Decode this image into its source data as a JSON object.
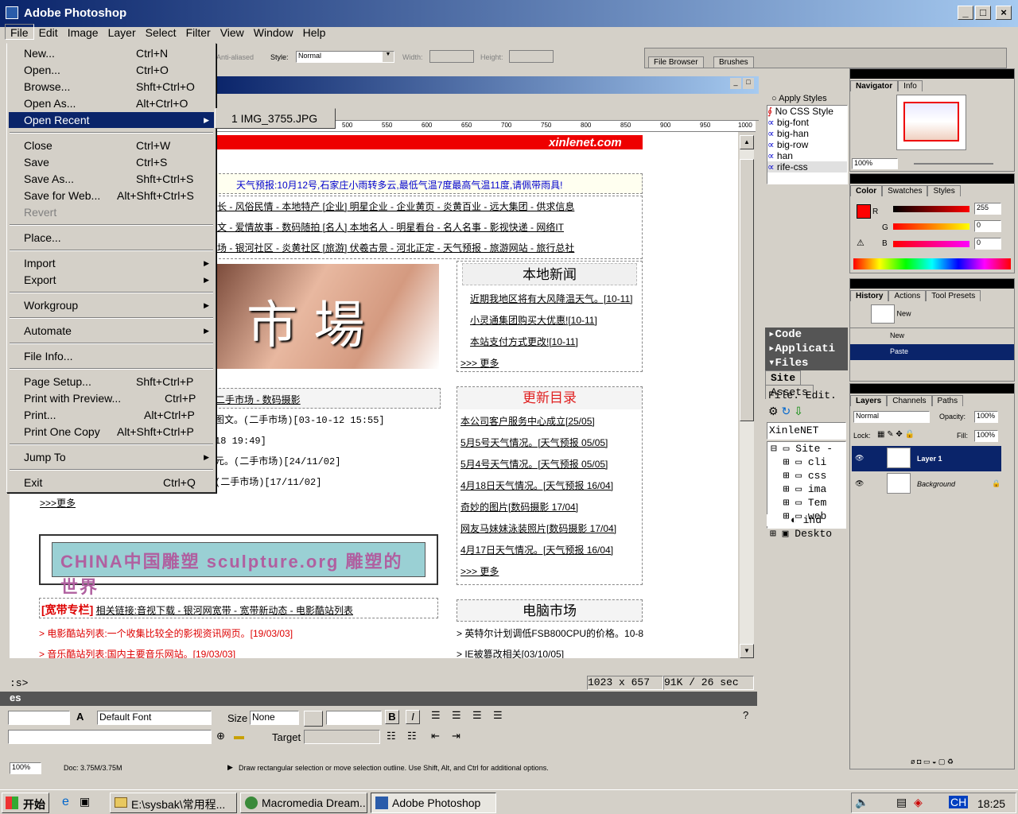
{
  "window": {
    "title": "Adobe Photoshop"
  },
  "menubar": [
    "File",
    "Edit",
    "Image",
    "Layer",
    "Select",
    "Filter",
    "View",
    "Window",
    "Help"
  ],
  "options": {
    "style_label": "Style:",
    "style_value": "Normal",
    "width_label": "Width:",
    "height_label": "Height:",
    "anti": "Anti-aliased",
    "file_browser": "File Browser",
    "brushes": "Brushes"
  },
  "file_menu": [
    {
      "label": "New...",
      "sc": "Ctrl+N"
    },
    {
      "label": "Open...",
      "sc": "Ctrl+O"
    },
    {
      "label": "Browse...",
      "sc": "Shft+Ctrl+O"
    },
    {
      "label": "Open As...",
      "sc": "Alt+Ctrl+O"
    },
    {
      "label": "Open Recent",
      "sc": ""
    },
    {
      "label": "Close",
      "sc": "Ctrl+W"
    },
    {
      "label": "Save",
      "sc": "Ctrl+S"
    },
    {
      "label": "Save As...",
      "sc": "Shft+Ctrl+S"
    },
    {
      "label": "Save for Web...",
      "sc": "Alt+Shft+Ctrl+S"
    },
    {
      "label": "Revert",
      "sc": ""
    },
    {
      "label": "Place...",
      "sc": ""
    },
    {
      "label": "Import",
      "sc": ""
    },
    {
      "label": "Export",
      "sc": ""
    },
    {
      "label": "Workgroup",
      "sc": ""
    },
    {
      "label": "Automate",
      "sc": ""
    },
    {
      "label": "File Info...",
      "sc": ""
    },
    {
      "label": "Page Setup...",
      "sc": "Shft+Ctrl+P"
    },
    {
      "label": "Print with Preview...",
      "sc": "Ctrl+P"
    },
    {
      "label": "Print...",
      "sc": "Alt+Ctrl+P"
    },
    {
      "label": "Print One Copy",
      "sc": "Alt+Shft+Ctrl+P"
    },
    {
      "label": "Jump To",
      "sc": ""
    },
    {
      "label": "Exit",
      "sc": "Ctrl+Q"
    }
  ],
  "recent": "1 IMG_3755.JPG",
  "web": {
    "weather": "天气预报:10月12号,石家庄小雨转多云,最低气温7度最高气温11度,请佩带雨具!",
    "nav_rows": [
      "长 - 风俗民情 - 本地特产    [企业] 明星企业 - 企业黄页 - 炎黄百业 - 远大集团 - 供求信息",
      "文 - 爱情故事 - 数码随拍    [名人] 本地名人 - 明星看台 - 名人名事 - 影视快递 - 网络IT",
      "场 - 银河社区 - 炎黄社区    [旅游] 伏羲古景 - 河北正定 - 天气预报 - 旅游网站 - 旅行总社"
    ],
    "logo": "xinlenet.com",
    "news_title": "本地新闻",
    "news": [
      "近期我地区将有大风降温天气。[10-11]",
      "小灵通集团购买大优惠![10-11]",
      "本站支付方式更改![10-11]",
      ">>> 更多"
    ],
    "market_head": "二手市场 - 数码摄影",
    "market": [
      "图文。(二手市场)[03-10-12 15:55]",
      "18 19:49]",
      "元。(二手市场)[24/11/02]",
      "(二手市场)[17/11/02]",
      ">>>更多"
    ],
    "update_title": "更新目录",
    "updates": [
      "本公司客户服务中心成立[25/05]",
      "5月5号天气情况。[天气预报 05/05]",
      "5月4号天气情况。[天气预报 05/05]",
      "4月18日天气情况。[天气预报 16/04]",
      "奇妙的图片[数码摄影 17/04]",
      "网友马妹妹泳装照片[数码摄影 17/04]",
      "4月17日天气情况。[天气预报 16/04]",
      ">>> 更多"
    ],
    "banner": "CHINA中国雕塑 sculpture.org  雕塑的世界",
    "broad_title": "[宽带专栏]",
    "broad_links": "相关链接:音视下载 - 银河网宽带 - 宽带新动态 - 电影酷站列表",
    "broad": [
      "> 电影酷站列表:一个收集比较全的影视资讯网页。[19/03/03]",
      "> 音乐酷站列表:国内主要音乐网站。[19/03/03]"
    ],
    "pc_title": "电脑市场",
    "pc": [
      "> 英特尔计划调低FSB800CPU的价格。10-8",
      "> IE被篡改相关[03/10/05]"
    ],
    "status_size": "1023 x 657",
    "status_dl": "91K / 26 sec"
  },
  "dw_props": {
    "font": "Default Font",
    "size_label": "Size",
    "size": "None",
    "target_label": "Target"
  },
  "styles": {
    "header": "Apply Styles",
    "items": [
      "No CSS Style",
      "big-font",
      "big-han",
      "big-row",
      "han",
      "rife-css"
    ]
  },
  "dw_panels": {
    "code": "Code",
    "app": "Applicati",
    "files": "Files",
    "site_tab": "Site",
    "assets_tab": "Assets",
    "file_menu": "File.",
    "edit_menu": "Edit.",
    "site_select": "XinleNET",
    "tree": [
      "Site -",
      "cli",
      "css",
      "ima",
      "Tem",
      "web",
      "ind",
      "Deskto"
    ]
  },
  "navigator": {
    "tabs": [
      "Navigator",
      "Info"
    ],
    "zoom": "100%"
  },
  "color": {
    "tabs": [
      "Color",
      "Swatches",
      "Styles"
    ],
    "r": "255",
    "g": "0",
    "b": "0",
    "accent": "#ff0000"
  },
  "history": {
    "tabs": [
      "History",
      "Actions",
      "Tool Presets"
    ],
    "items": [
      "New",
      "New",
      "Paste"
    ]
  },
  "layers": {
    "tabs": [
      "Layers",
      "Channels",
      "Paths"
    ],
    "mode": "Normal",
    "opacity_label": "Opacity:",
    "opacity": "100%",
    "lock": "Lock:",
    "fill_label": "Fill:",
    "fill": "100%",
    "items": [
      "Layer 1",
      "Background"
    ]
  },
  "status": {
    "zoom": "100%",
    "doc": "Doc: 3.75M/3.75M",
    "hint": "Draw rectangular selection or move selection outline.  Use Shift, Alt, and Ctrl for additional options."
  },
  "taskbar": {
    "start": "开始",
    "items": [
      "E:\\sysbak\\常用程...",
      "Macromedia Dream...",
      "Adobe Photoshop"
    ],
    "clock": "18:25",
    "ime": "CH"
  }
}
